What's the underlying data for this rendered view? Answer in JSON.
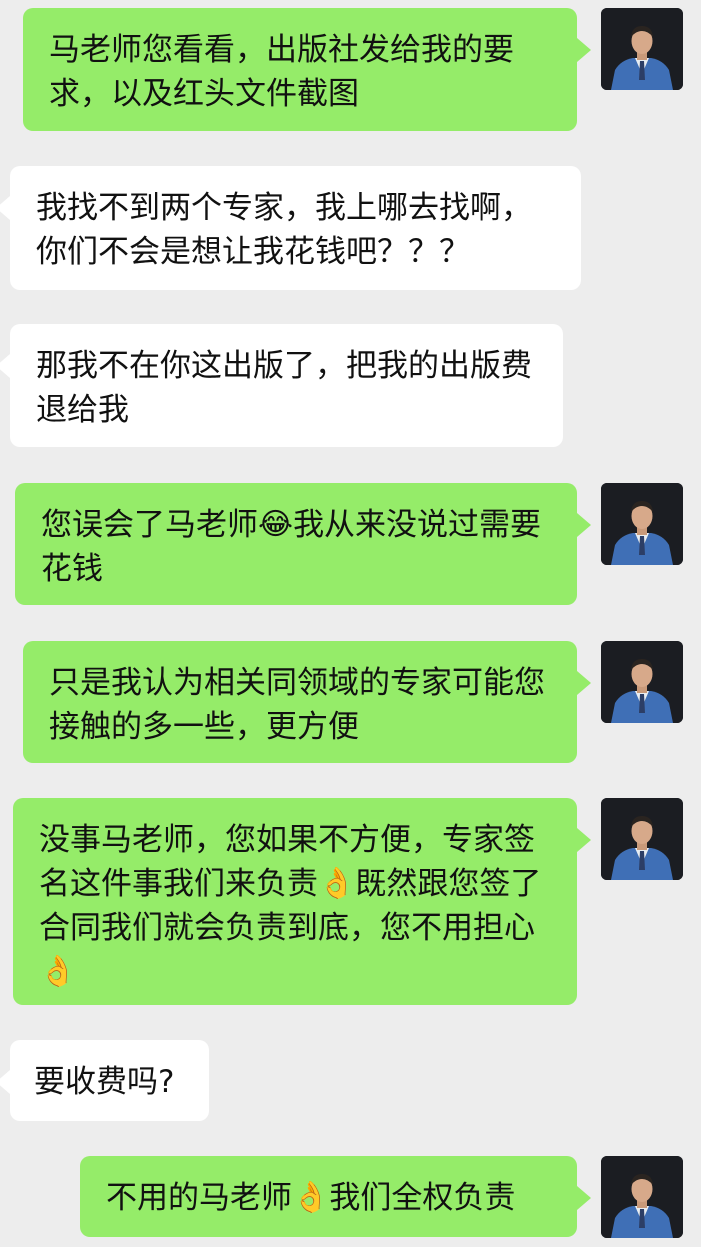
{
  "messages": [
    {
      "role": "sent",
      "parts": [
        {
          "text": "马老师您看看，出版社发给我的要求，以及红头文件截图"
        }
      ]
    },
    {
      "role": "received",
      "parts": [
        {
          "text": "我找不到两个专家，我上哪去找啊，你们不会是想让我花钱吧？？？"
        }
      ]
    },
    {
      "role": "received",
      "parts": [
        {
          "text": "那我不在你这出版了，把我的出版费退给我"
        }
      ]
    },
    {
      "role": "sent",
      "parts": [
        {
          "text": "您误会了马老师"
        },
        {
          "emoji": "😂",
          "emoji_name": "face-with-tears-of-joy"
        },
        {
          "text": "我从来没说过需要花钱"
        }
      ]
    },
    {
      "role": "sent",
      "parts": [
        {
          "text": "只是我认为相关同领域的专家可能您接触的多一些，更方便"
        }
      ]
    },
    {
      "role": "sent",
      "parts": [
        {
          "text": "没事马老师，您如果不方便，专家签名这件事我们来负责"
        },
        {
          "emoji": "👌",
          "emoji_name": "ok-hand"
        },
        {
          "text": "既然跟您签了合同我们就会负责到底，您不用担心"
        },
        {
          "emoji": "👌",
          "emoji_name": "ok-hand"
        }
      ]
    },
    {
      "role": "received",
      "parts": [
        {
          "text": "要收费吗?"
        }
      ]
    },
    {
      "role": "sent",
      "parts": [
        {
          "text": "不用的马老师"
        },
        {
          "emoji": "👌",
          "emoji_name": "ok-hand"
        },
        {
          "text": "我们全权负责"
        }
      ]
    }
  ],
  "colors": {
    "background": "#ededed",
    "sent_bubble": "#95ec69",
    "received_bubble": "#ffffff",
    "text": "#111111",
    "avatar_jacket": "#3f6fb6"
  },
  "icons": {
    "avatar": "person-avatar-icon",
    "emoji_laugh": "face-with-tears-of-joy-icon",
    "emoji_ok": "ok-hand-icon"
  }
}
